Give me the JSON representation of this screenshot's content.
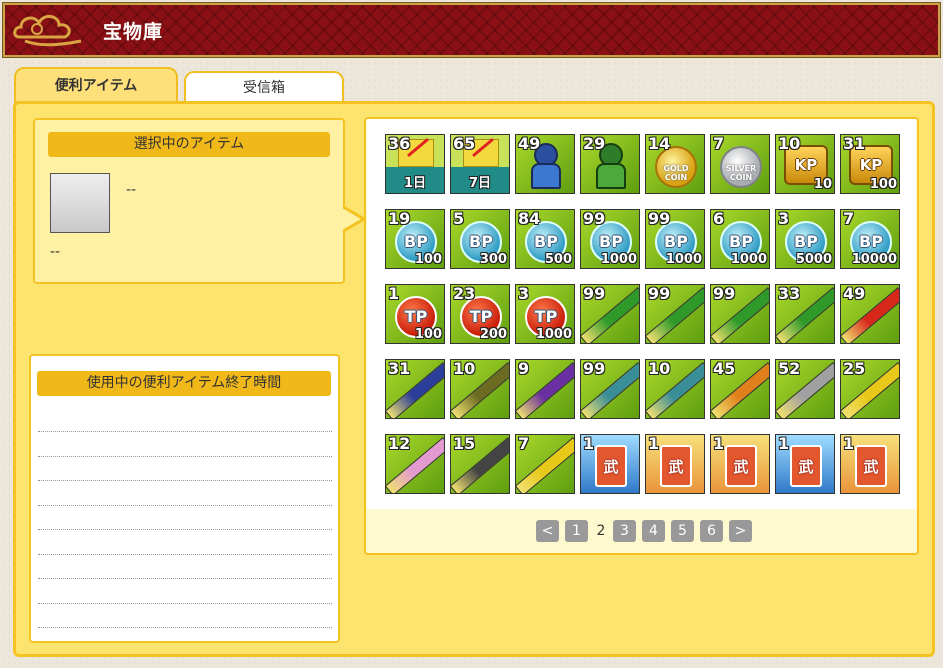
{
  "header": {
    "title": "宝物庫"
  },
  "tabs": [
    {
      "label": "便利アイテム",
      "active": true
    },
    {
      "label": "受信箱",
      "active": false
    }
  ],
  "selected": {
    "header": "選択中のアイテム",
    "name": "--",
    "description": "--"
  },
  "active_items": {
    "header": "使用中の便利アイテム終了時間",
    "rows": [
      "",
      "",
      "",
      "",
      "",
      "",
      "",
      "",
      ""
    ]
  },
  "items": [
    {
      "qty": "36",
      "label": "1日",
      "icon": "exp-boost-1day-icon"
    },
    {
      "qty": "65",
      "label": "7日",
      "icon": "exp-boost-7day-icon"
    },
    {
      "qty": "49",
      "label": "",
      "icon": "blue-soldier-icon"
    },
    {
      "qty": "29",
      "label": "",
      "icon": "green-soldier-icon"
    },
    {
      "qty": "14",
      "label": "",
      "icon": "gold-coin-icon",
      "text": "GOLD COIN"
    },
    {
      "qty": "7",
      "label": "",
      "icon": "silver-coin-icon",
      "text": "SILVER COIN"
    },
    {
      "qty": "10",
      "label": "10",
      "icon": "kp-coin-icon",
      "text": "KP"
    },
    {
      "qty": "31",
      "label": "100",
      "icon": "kp-coin-icon",
      "text": "KP"
    },
    {
      "qty": "19",
      "label": "100",
      "icon": "bp-coin-icon",
      "text": "BP"
    },
    {
      "qty": "5",
      "label": "300",
      "icon": "bp-coin-icon",
      "text": "BP"
    },
    {
      "qty": "84",
      "label": "500",
      "icon": "bp-coin-icon",
      "text": "BP"
    },
    {
      "qty": "99",
      "label": "1000",
      "icon": "bp-coin-icon",
      "text": "BP"
    },
    {
      "qty": "99",
      "label": "1000",
      "icon": "bp-coin-icon",
      "text": "BP"
    },
    {
      "qty": "6",
      "label": "1000",
      "icon": "bp-coin-icon",
      "text": "BP"
    },
    {
      "qty": "3",
      "label": "5000",
      "icon": "bp-coin-icon",
      "text": "BP"
    },
    {
      "qty": "7",
      "label": "10000",
      "icon": "bp-coin-icon",
      "text": "BP"
    },
    {
      "qty": "1",
      "label": "100",
      "icon": "tp-coin-icon",
      "text": "TP"
    },
    {
      "qty": "23",
      "label": "200",
      "icon": "tp-coin-icon",
      "text": "TP"
    },
    {
      "qty": "3",
      "label": "1000",
      "icon": "tp-coin-icon",
      "text": "TP"
    },
    {
      "qty": "99",
      "label": "",
      "icon": "green-stick-icon",
      "color": "#2f9a2a"
    },
    {
      "qty": "99",
      "label": "",
      "icon": "green-stick-icon",
      "color": "#2f9a2a"
    },
    {
      "qty": "99",
      "label": "",
      "icon": "green-stick-icon",
      "color": "#2f9a2a"
    },
    {
      "qty": "33",
      "label": "",
      "icon": "green-stick-icon",
      "color": "#2f9a2a"
    },
    {
      "qty": "49",
      "label": "",
      "icon": "red-stick-icon",
      "color": "#d8281c"
    },
    {
      "qty": "31",
      "label": "",
      "icon": "navy-stick-icon",
      "color": "#2b3e9a"
    },
    {
      "qty": "10",
      "label": "",
      "icon": "olive-stick-icon",
      "color": "#6b6b22"
    },
    {
      "qty": "9",
      "label": "",
      "icon": "purple-stick-icon",
      "color": "#6a2fa0"
    },
    {
      "qty": "99",
      "label": "",
      "icon": "teal-stick-icon",
      "color": "#3a8e98"
    },
    {
      "qty": "10",
      "label": "",
      "icon": "teal-stick-icon",
      "color": "#3a8e98"
    },
    {
      "qty": "45",
      "label": "",
      "icon": "orange-stick-icon",
      "color": "#e0801c"
    },
    {
      "qty": "52",
      "label": "",
      "icon": "s-stick-icon",
      "color": "#a0a0a0"
    },
    {
      "qty": "25",
      "label": "",
      "icon": "g-stick-icon",
      "color": "#e8c818"
    },
    {
      "qty": "12",
      "label": "",
      "icon": "p-stick-icon",
      "color": "#e39ad0"
    },
    {
      "qty": "15",
      "label": "",
      "icon": "d-stick-icon",
      "color": "#444444"
    },
    {
      "qty": "7",
      "label": "",
      "icon": "c-stick-icon",
      "color": "#e8c818"
    },
    {
      "qty": "1",
      "label": "",
      "icon": "bushou-card-blue-icon",
      "text": "武"
    },
    {
      "qty": "1",
      "label": "",
      "icon": "bushou-card-gold-icon",
      "text": "武"
    },
    {
      "qty": "1",
      "label": "",
      "icon": "bushou-card-gold-icon",
      "text": "武"
    },
    {
      "qty": "1",
      "label": "",
      "icon": "bushou-card-blue-icon",
      "text": "武"
    },
    {
      "qty": "1",
      "label": "",
      "icon": "bushou-card-gold-icon",
      "text": "武"
    }
  ],
  "pager": {
    "prev": "<",
    "pages": [
      "1",
      "2",
      "3",
      "4",
      "5",
      "6"
    ],
    "current": "2",
    "next": ">"
  }
}
